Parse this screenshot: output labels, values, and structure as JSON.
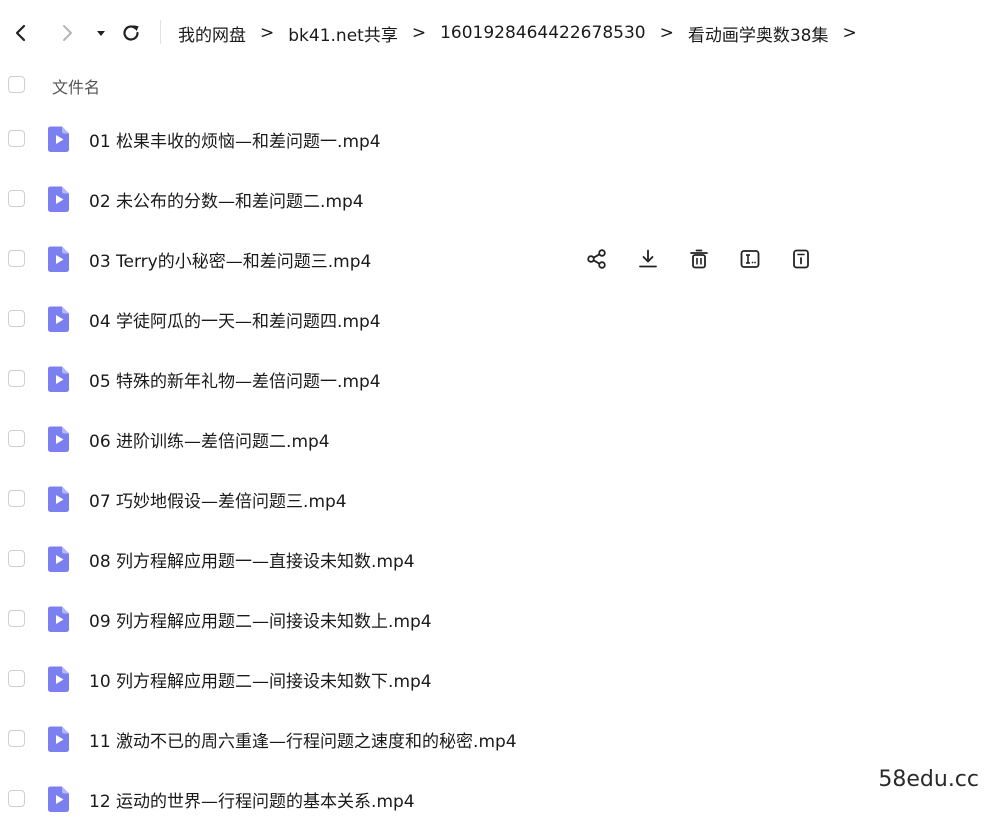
{
  "toolbar": {
    "back_icon": "chevron-left-icon",
    "forward_icon": "chevron-right-icon",
    "history_icon": "caret-down-icon",
    "refresh_icon": "refresh-icon"
  },
  "breadcrumb": {
    "items": [
      "我的网盘",
      "bk41.net共享",
      "1601928464422678530",
      "看动画学奥数38集"
    ],
    "separator": ">"
  },
  "list_header": {
    "name_label": "文件名"
  },
  "files": [
    {
      "name": "01 松果丰收的烦恼—和差问题一.mp4"
    },
    {
      "name": "02 未公布的分数—和差问题二.mp4"
    },
    {
      "name": "03 Terry的小秘密—和差问题三.mp4"
    },
    {
      "name": "04 学徒阿瓜的一天—和差问题四.mp4"
    },
    {
      "name": "05 特殊的新年礼物—差倍问题一.mp4"
    },
    {
      "name": "06 进阶训练—差倍问题二.mp4"
    },
    {
      "name": "07 巧妙地假设—差倍问题三.mp4"
    },
    {
      "name": "08 列方程解应用题一—直接设未知数.mp4"
    },
    {
      "name": "09 列方程解应用题二—间接设未知数上.mp4"
    },
    {
      "name": "10 列方程解应用题二—间接设未知数下.mp4"
    },
    {
      "name": "11 激动不已的周六重逢—行程问题之速度和的秘密.mp4"
    },
    {
      "name": "12 运动的世界—行程问题的基本关系.mp4"
    }
  ],
  "hover_row_index": 2,
  "row_actions": [
    "share-icon",
    "download-icon",
    "delete-icon",
    "rename-icon",
    "details-icon"
  ],
  "watermark": "58edu.cc",
  "colors": {
    "file_icon": "#7b7ff0",
    "text": "#1a1a1a",
    "muted": "#555555",
    "checkbox_border": "#cfcfcf"
  }
}
